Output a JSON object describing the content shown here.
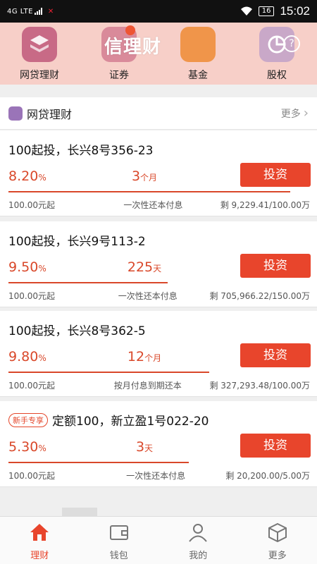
{
  "status_bar": {
    "network": "4G LTE",
    "battery": "16",
    "time": "15:02"
  },
  "top_nav": {
    "watermark": "信理财",
    "categories": [
      {
        "label": "网贷理财",
        "icon": "layers-icon"
      },
      {
        "label": "证券",
        "icon": "stock-icon"
      },
      {
        "label": "基金",
        "icon": "coin-icon"
      },
      {
        "label": "股权",
        "icon": "pie-icon"
      }
    ]
  },
  "section": {
    "title": "网贷理财",
    "more": "更多"
  },
  "products": [
    {
      "name": "100起投，长兴8号356-23",
      "tag": "",
      "rate": "8.20",
      "rate_unit": "%",
      "term": "3",
      "term_unit": "个月",
      "button": "投资",
      "progress": 0.94,
      "min_amount": "100.00元起",
      "method": "一次性还本付息",
      "remaining": "剩 9,229.41/100.00万"
    },
    {
      "name": "100起投，长兴9号113-2",
      "tag": "",
      "rate": "9.50",
      "rate_unit": "%",
      "term": "225",
      "term_unit": "天",
      "button": "投资",
      "progress": 0.53,
      "min_amount": "100.00元起",
      "method": "一次性还本付息",
      "remaining": "剩 705,966.22/150.00万"
    },
    {
      "name": "100起投，长兴8号362-5",
      "tag": "",
      "rate": "9.80",
      "rate_unit": "%",
      "term": "12",
      "term_unit": "个月",
      "button": "投资",
      "progress": 0.67,
      "min_amount": "100.00元起",
      "method": "按月付息到期还本",
      "remaining": "剩 327,293.48/100.00万"
    },
    {
      "name": "定额100，新立盈1号022-20",
      "tag": "新手专享",
      "rate": "5.30",
      "rate_unit": "%",
      "term": "3",
      "term_unit": "天",
      "button": "投资",
      "progress": 0.6,
      "min_amount": "100.00元起",
      "method": "一次性还本付息",
      "remaining": "剩 20,200.00/5.00万"
    }
  ],
  "tabs": [
    {
      "label": "理财",
      "icon": "home-icon",
      "active": true
    },
    {
      "label": "钱包",
      "icon": "wallet-icon",
      "active": false
    },
    {
      "label": "我的",
      "icon": "user-icon",
      "active": false
    },
    {
      "label": "更多",
      "icon": "cube-icon",
      "active": false
    }
  ],
  "colors": {
    "accent": "#e8452c",
    "header_bg": "#f7cfc8"
  }
}
